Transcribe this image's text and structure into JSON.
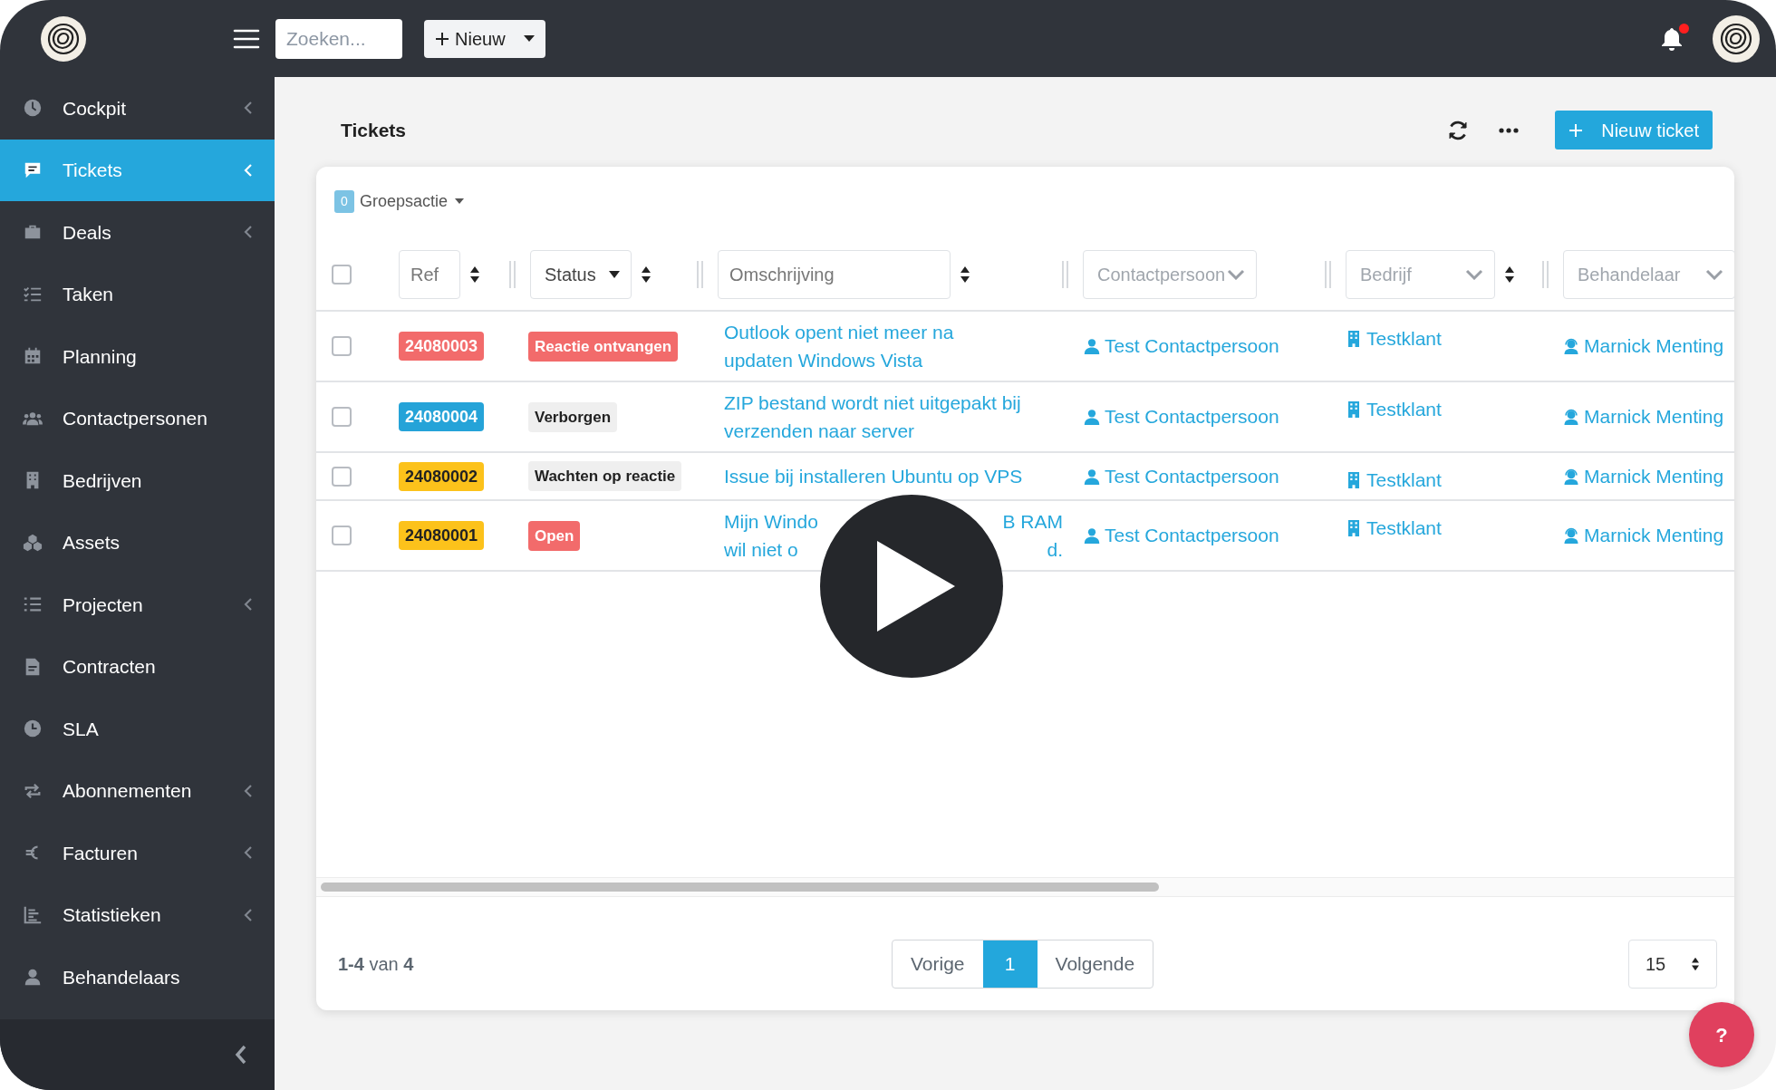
{
  "topbar": {
    "search": {
      "placeholder": "Zoeken..."
    },
    "new_button": "Nieuw",
    "notifications_unread": true
  },
  "sidebar": {
    "items": [
      {
        "label": "Cockpit",
        "selected": false,
        "expandable": true
      },
      {
        "label": "Tickets",
        "selected": true,
        "expandable": true
      },
      {
        "label": "Deals",
        "selected": false,
        "expandable": true
      },
      {
        "label": "Taken",
        "selected": false,
        "expandable": false
      },
      {
        "label": "Planning",
        "selected": false,
        "expandable": false
      },
      {
        "label": "Contactpersonen",
        "selected": false,
        "expandable": false
      },
      {
        "label": "Bedrijven",
        "selected": false,
        "expandable": false
      },
      {
        "label": "Assets",
        "selected": false,
        "expandable": false
      },
      {
        "label": "Projecten",
        "selected": false,
        "expandable": true
      },
      {
        "label": "Contracten",
        "selected": false,
        "expandable": false
      },
      {
        "label": "SLA",
        "selected": false,
        "expandable": false
      },
      {
        "label": "Abonnementen",
        "selected": false,
        "expandable": true
      },
      {
        "label": "Facturen",
        "selected": false,
        "expandable": true
      },
      {
        "label": "Statistieken",
        "selected": false,
        "expandable": true
      },
      {
        "label": "Behandelaars",
        "selected": false,
        "expandable": false
      }
    ]
  },
  "page": {
    "title": "Tickets",
    "new_ticket_button": "Nieuw ticket"
  },
  "bulk_action": {
    "count": "0",
    "label": "Groepsactie"
  },
  "select_all_checked": false,
  "filters": [
    {
      "kind": "input",
      "placeholder": "Ref",
      "sortable": true
    },
    {
      "kind": "dropdown",
      "value": "Status",
      "sortable": true
    },
    {
      "kind": "input",
      "placeholder": "Omschrijving",
      "sortable": true
    },
    {
      "kind": "select",
      "placeholder": "Contactpersoon",
      "sortable": false
    },
    {
      "kind": "select",
      "placeholder": "Bedrijf",
      "sortable": true
    },
    {
      "kind": "select",
      "placeholder": "Behandelaar",
      "sortable": false
    }
  ],
  "rows": [
    {
      "checked": false,
      "ref": {
        "text": "24080003",
        "color": "#f26b6b"
      },
      "status": {
        "text": "Reactie ontvangen",
        "color": "#f26b6b"
      },
      "description": [
        [
          "Outlook opent niet meer na"
        ],
        [
          "updaten Windows Vista"
        ]
      ],
      "contact": "Test Contactpersoon",
      "company": "Testklant",
      "agent": "Marnick Menting"
    },
    {
      "checked": false,
      "ref": {
        "text": "24080004",
        "color": "#25a3d8"
      },
      "status": {
        "text": "Verborgen",
        "color": "#efefef"
      },
      "description": [
        [
          "ZIP bestand wordt niet uitgepakt bij"
        ],
        [
          "verzenden naar server"
        ]
      ],
      "contact": "Test Contactpersoon",
      "company": "Testklant",
      "agent": "Marnick Menting"
    },
    {
      "checked": false,
      "ref": {
        "text": "24080002",
        "color": "#fcc21b"
      },
      "status": {
        "text": "Wachten op reactie",
        "color": "#efefef"
      },
      "description": [
        [
          "Issue bij installeren Ubuntu op VPS"
        ]
      ],
      "contact": "Test Contactpersoon",
      "company": "Testklant",
      "agent": "Marnick Menting"
    },
    {
      "checked": false,
      "ref": {
        "text": "24080001",
        "color": "#fcc21b"
      },
      "status": {
        "text": "Open",
        "color": "#f26b6b"
      },
      "description": [
        [
          "Mijn Windo",
          "B RAM"
        ],
        [
          "wil niet o",
          "d."
        ]
      ],
      "contact": "Test Contactpersoon",
      "company": "Testklant",
      "agent": "Marnick Menting"
    }
  ],
  "footer": {
    "range": "**1-4** van **4**",
    "previous": "Vorige",
    "pages": [
      {
        "label": "1",
        "selected": true
      }
    ],
    "next": "Volgende",
    "per_page": "15"
  },
  "help_button": "?"
}
